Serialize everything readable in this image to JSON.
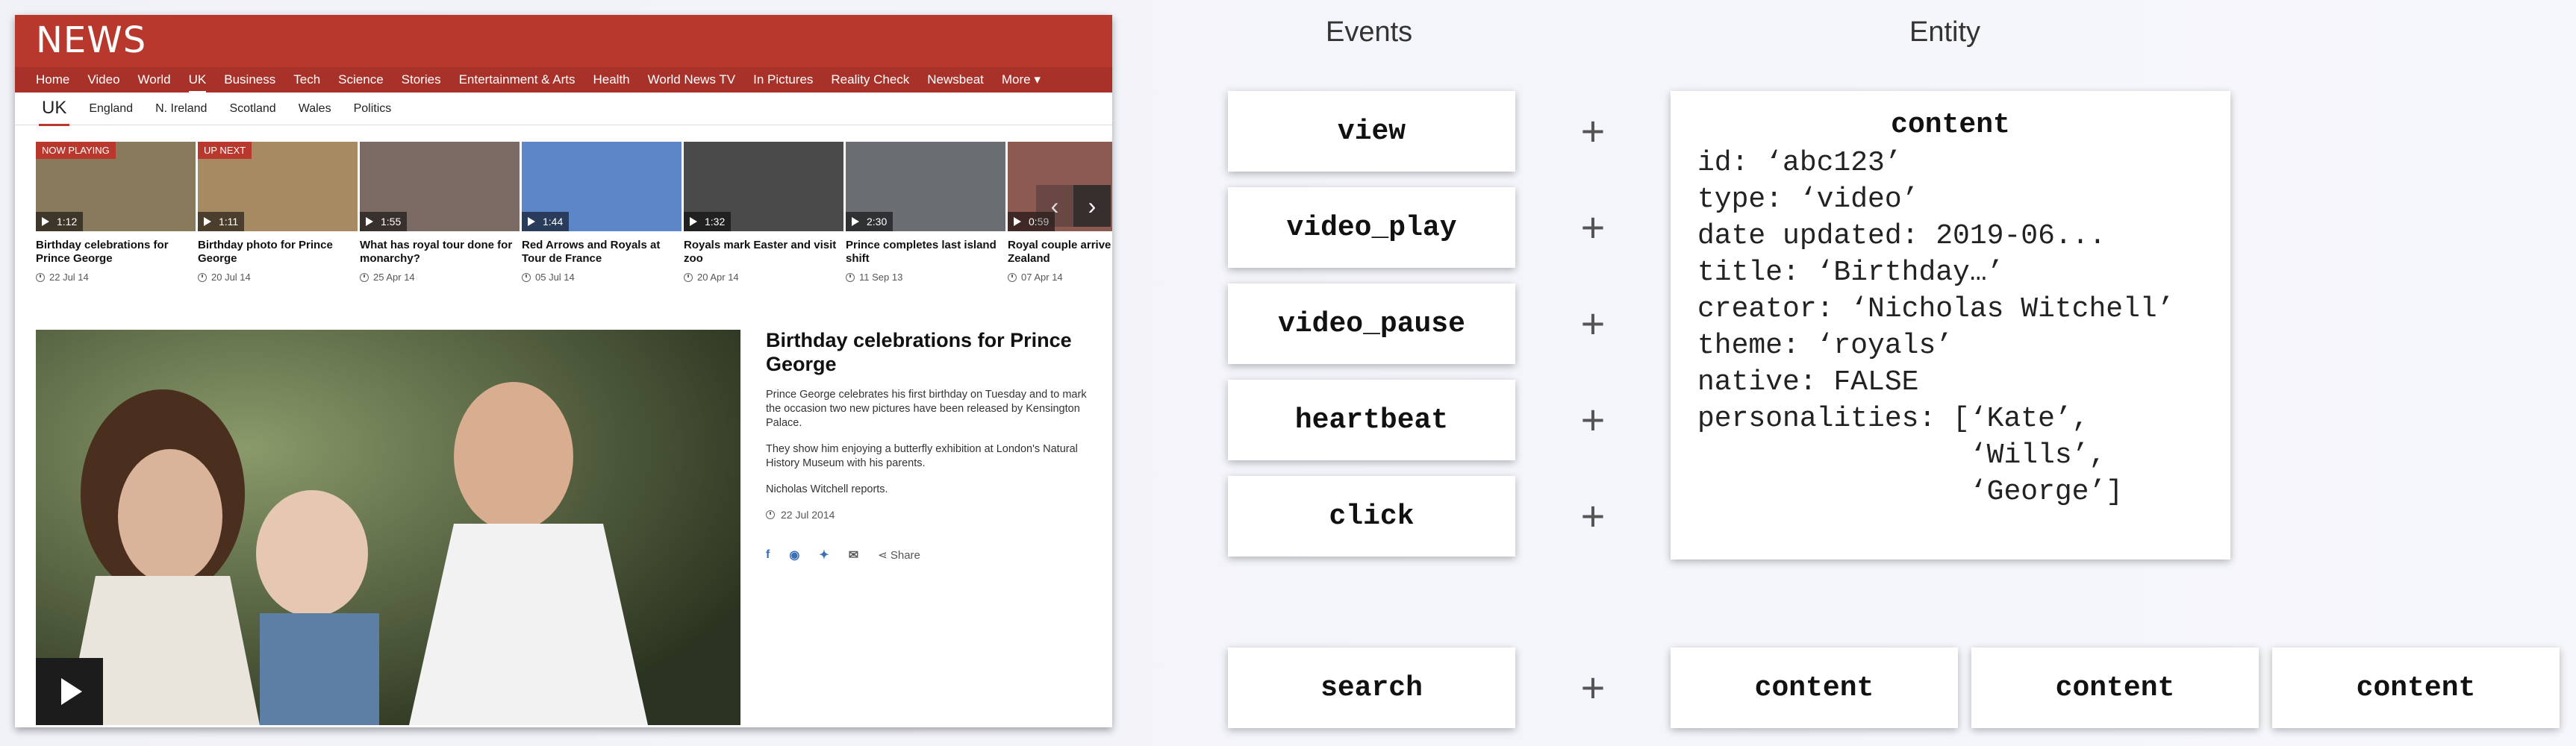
{
  "news": {
    "logo": "NEWS",
    "nav": [
      "Home",
      "Video",
      "World",
      "UK",
      "Business",
      "Tech",
      "Science",
      "Stories",
      "Entertainment & Arts",
      "Health",
      "World News TV",
      "In Pictures",
      "Reality Check",
      "Newsbeat",
      "More ▾"
    ],
    "nav_active": "UK",
    "subnav": [
      "UK",
      "England",
      "N. Ireland",
      "Scotland",
      "Wales",
      "Politics"
    ],
    "cards": [
      {
        "badge": "NOW PLAYING",
        "duration": "1:12",
        "title": "Birthday celebrations for Prince George",
        "date": "22 Jul 14",
        "color": "#8a7a5c"
      },
      {
        "badge": "UP NEXT",
        "duration": "1:11",
        "title": "Birthday photo for Prince George",
        "date": "20 Jul 14",
        "color": "#a88a62"
      },
      {
        "badge": "",
        "duration": "1:55",
        "title": "What has royal tour done for monarchy?",
        "date": "25 Apr 14",
        "color": "#7b6a63"
      },
      {
        "badge": "",
        "duration": "1:44",
        "title": "Red Arrows and Royals at Tour de France",
        "date": "05 Jul 14",
        "color": "#5d86c9"
      },
      {
        "badge": "",
        "duration": "1:32",
        "title": "Royals mark Easter and visit zoo",
        "date": "20 Apr 14",
        "color": "#4a4a4a"
      },
      {
        "badge": "",
        "duration": "2:30",
        "title": "Prince completes last island shift",
        "date": "11 Sep 13",
        "color": "#6a6e73"
      },
      {
        "badge": "",
        "duration": "0:59",
        "title": "Royal couple arrive in New Zealand",
        "date": "07 Apr 14",
        "color": "#8d5a52"
      }
    ],
    "article": {
      "title": "Birthday celebrations for Prince George",
      "p1": "Prince George celebrates his first birthday on Tuesday and to mark the occasion two new pictures have been released by Kensington Palace.",
      "p2": "They show him enjoying a butterfly exhibition at London's Natural History Museum with his parents.",
      "p3": "Nicholas Witchell reports.",
      "date": "22 Jul 2014",
      "share_label": "Share"
    }
  },
  "diagram": {
    "events_title": "Events",
    "entity_title": "Entity",
    "events": [
      "view",
      "video_play",
      "video_pause",
      "heartbeat",
      "click"
    ],
    "plus": "+",
    "entity": {
      "name": "content",
      "lines": [
        "id: ‘abc123’",
        "type: ‘video’",
        "date updated: 2019-06...",
        "title: ‘Birthday…’",
        "creator: ‘Nicholas Witchell’",
        "theme: ‘royals’",
        "native: FALSE",
        "personalities: [‘Kate’,",
        "                ‘Wills’,",
        "                ‘George’]"
      ]
    },
    "search_event": "search",
    "search_entities": [
      "content",
      "content",
      "content"
    ]
  }
}
